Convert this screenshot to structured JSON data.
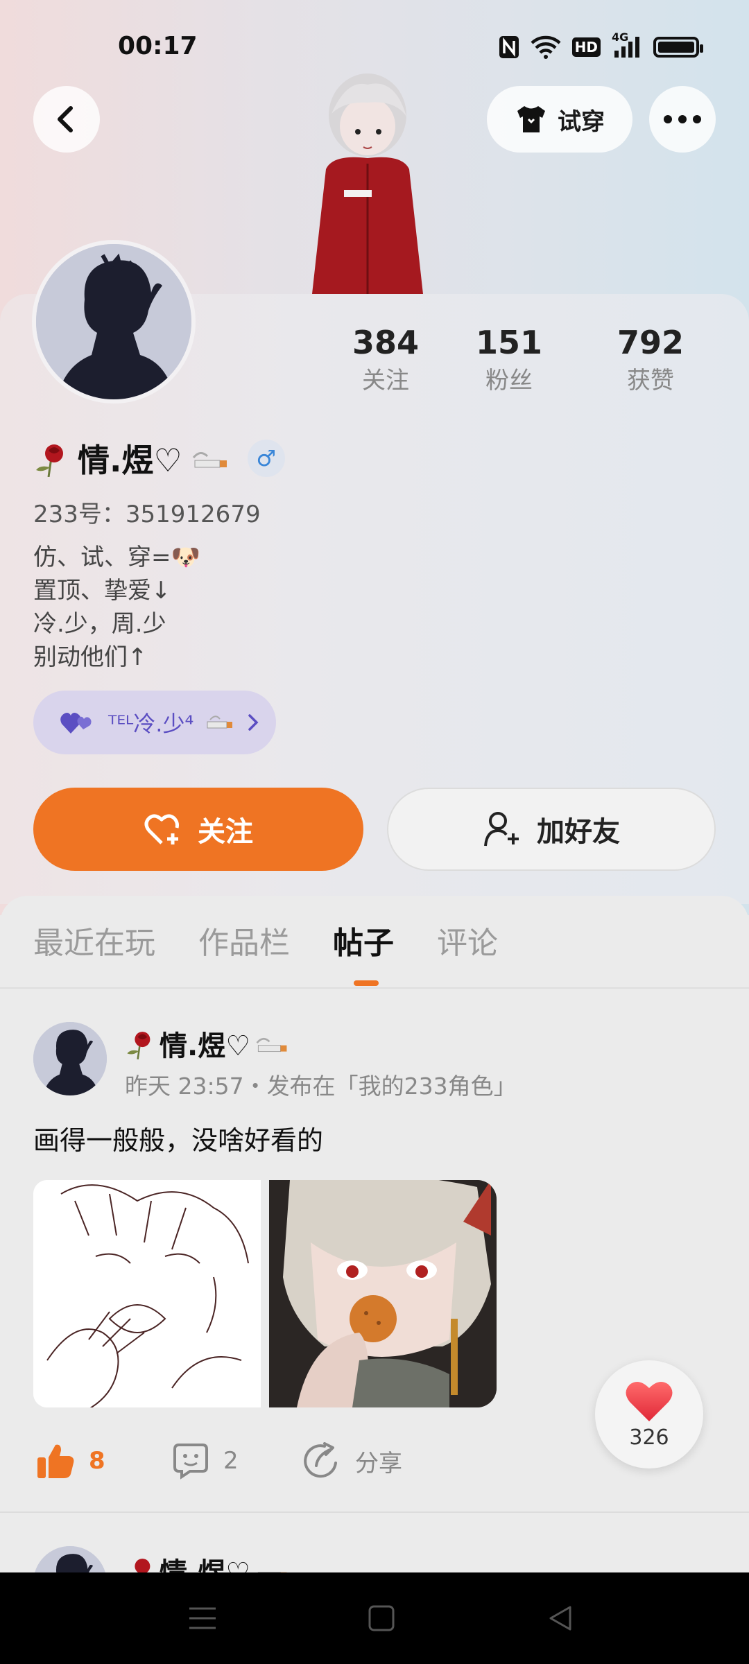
{
  "status_bar": {
    "time": "00:17",
    "icons": [
      "nfc-icon",
      "wifi-icon",
      "hd-icon",
      "4g-signal-icon",
      "battery-icon"
    ],
    "hd_text": "HD",
    "network_text": "4G"
  },
  "header": {
    "tryon_label": "试穿"
  },
  "profile": {
    "name": "情.煜♡",
    "gender_symbol": "♂",
    "uid": "233号：351912679",
    "bio": [
      "仿、试、穿=🐶",
      "置顶、挚爱↓",
      "冷.少，周.少",
      "别动他们↑"
    ],
    "couple_name": "ᵀᴱᴸ冷.少⁴",
    "stats": [
      {
        "value": "384",
        "label": "关注"
      },
      {
        "value": "151",
        "label": "粉丝"
      },
      {
        "value": "792",
        "label": "获赞"
      }
    ]
  },
  "actions": {
    "follow_label": "关注",
    "add_friend_label": "加好友"
  },
  "tabs": [
    "最近在玩",
    "作品栏",
    "帖子",
    "评论"
  ],
  "active_tab": "帖子",
  "post": {
    "author": "情.煜♡",
    "meta": "昨天 23:57・发布在「我的233角色」",
    "text": "画得一般般，没啥好看的",
    "likes": "8",
    "comments": "2",
    "share_label": "分享"
  },
  "floating_like_count": "326",
  "next_post": {
    "author": "情.煜♡"
  },
  "colors": {
    "accent": "#ef7423",
    "couple_pill": "#d9d4ec",
    "gender": "#3a86d8"
  }
}
